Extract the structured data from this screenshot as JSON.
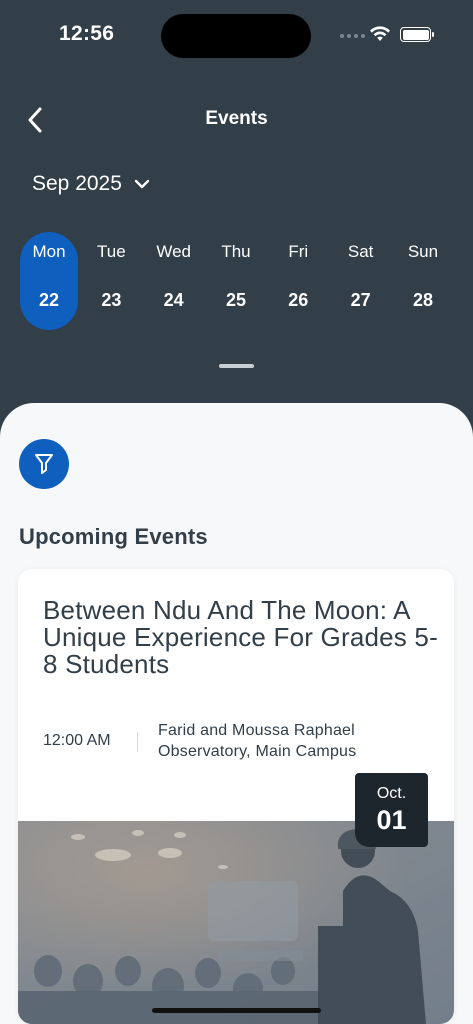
{
  "status_bar": {
    "time": "12:56"
  },
  "header": {
    "title": "Events"
  },
  "calendar": {
    "month_label": "Sep 2025",
    "days": [
      {
        "dow": "Mon",
        "num": "22",
        "selected": true
      },
      {
        "dow": "Tue",
        "num": "23",
        "selected": false
      },
      {
        "dow": "Wed",
        "num": "24",
        "selected": false
      },
      {
        "dow": "Thu",
        "num": "25",
        "selected": false
      },
      {
        "dow": "Fri",
        "num": "26",
        "selected": false
      },
      {
        "dow": "Sat",
        "num": "27",
        "selected": false
      },
      {
        "dow": "Sun",
        "num": "28",
        "selected": false
      }
    ]
  },
  "events": {
    "section_title": "Upcoming Events",
    "items": [
      {
        "title": "Between Ndu And The Moon: A Unique Experience For Grades 5-8 Students",
        "time": "12:00 AM",
        "location": "Farid and Moussa Raphael Observatory, Main Campus",
        "badge_month": "Oct.",
        "badge_day": "01"
      }
    ]
  },
  "colors": {
    "header_bg": "#323e48",
    "accent": "#0f5fbf",
    "sheet_bg": "#f7f8f9",
    "badge_bg": "#1e262d"
  },
  "icons": {
    "back": "chevron-left-icon",
    "month_dropdown": "chevron-down-icon",
    "filter": "filter-icon",
    "wifi": "wifi-icon",
    "battery": "battery-icon"
  }
}
